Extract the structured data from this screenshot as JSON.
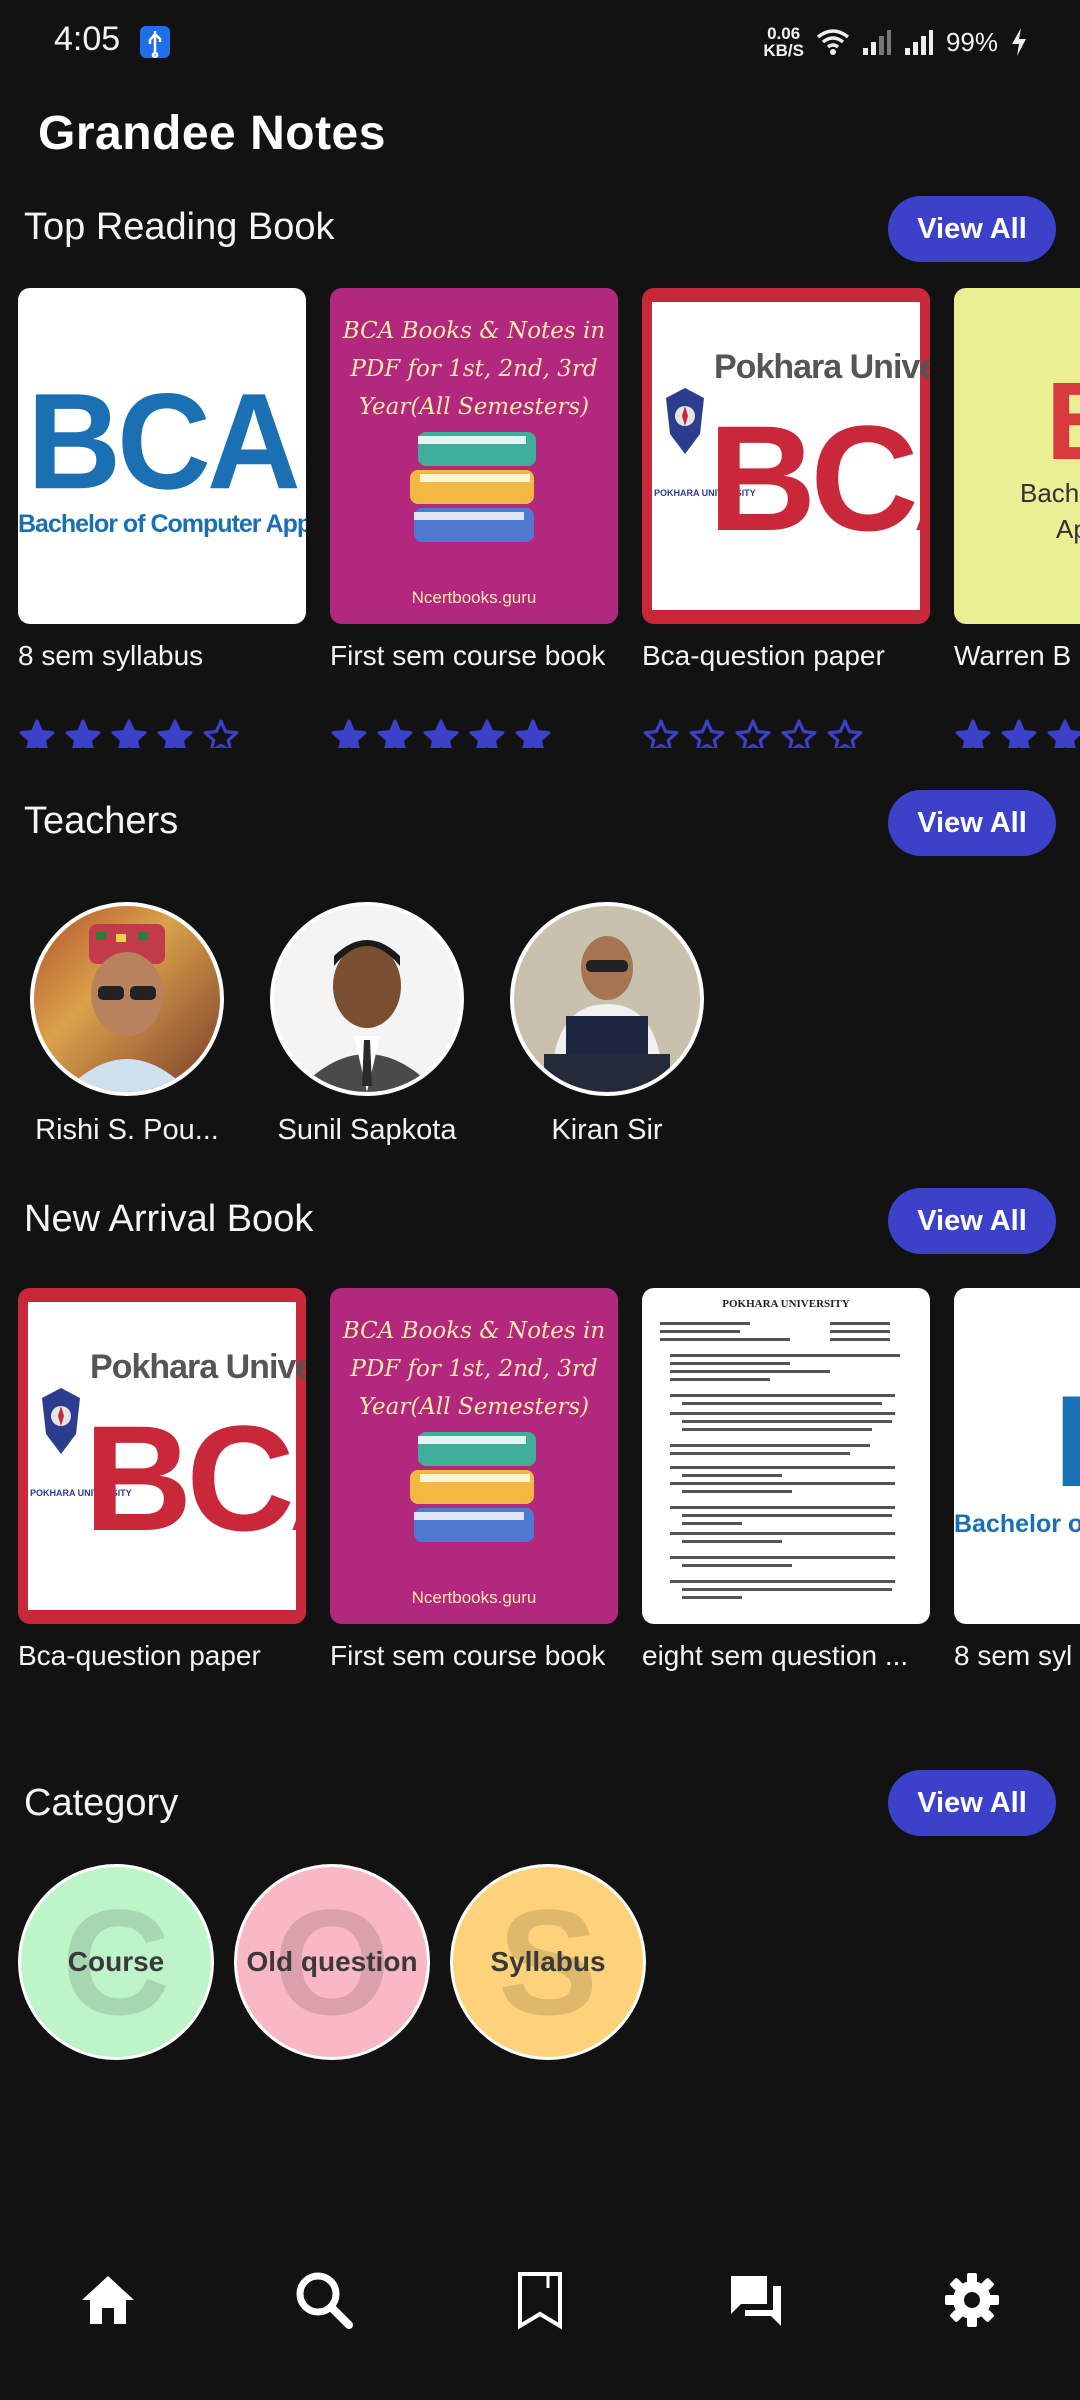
{
  "status": {
    "time": "4:05",
    "net_speed_value": "0.06",
    "net_speed_unit": "KB/S",
    "battery": "99%"
  },
  "app": {
    "title": "Grandee Notes"
  },
  "colors": {
    "accent": "#3b42c9",
    "background": "#121212",
    "star": "#3b42c9"
  },
  "top_reading": {
    "title": "Top Reading Book",
    "view_all": "View All",
    "books": [
      {
        "title": "8 sem syllabus",
        "cover_big": "BCA",
        "cover_sub": "Bachelor of Computer Application",
        "rating": 4
      },
      {
        "title": "First sem course book",
        "cover_text": "BCA Books & Notes in PDF for 1st, 2nd, 3rd Year(All Semesters)",
        "cover_footer": "Ncertbooks.guru",
        "rating": 5
      },
      {
        "title": "Bca-question paper",
        "cover_top": "Pokhara University",
        "cover_big": "BCA",
        "cover_side": "POKHARA UNIVERSITY",
        "rating": 0
      },
      {
        "title": "Warren B",
        "cover_big": "B",
        "cover_sub": "Bachel",
        "cover_sub2": "Ap",
        "rating": 3
      }
    ]
  },
  "teachers": {
    "title": "Teachers",
    "view_all": "View All",
    "items": [
      {
        "name": "Rishi S. Pou..."
      },
      {
        "name": "Sunil Sapkota"
      },
      {
        "name": "Kiran Sir"
      }
    ]
  },
  "new_arrival": {
    "title": "New Arrival Book",
    "view_all": "View All",
    "books": [
      {
        "title": "Bca-question paper",
        "cover_top": "Pokhara University",
        "cover_big": "BCA",
        "cover_side": "POKHARA UNIVERSITY"
      },
      {
        "title": "First sem course book",
        "cover_text": "BCA Books & Notes in PDF for 1st, 2nd, 3rd Year(All Semesters)",
        "cover_footer": "Ncertbooks.guru"
      },
      {
        "title": "eight sem question ...",
        "doc_heading": "POKHARA UNIVERSITY"
      },
      {
        "title": "8 sem syl",
        "cover_big": "B",
        "cover_sub": "Bachelor of Co"
      }
    ]
  },
  "category": {
    "title": "Category",
    "view_all": "View All",
    "items": [
      {
        "label": "Course",
        "letter": "C",
        "color": "#bdf5c9"
      },
      {
        "label": "Old question",
        "letter": "O",
        "color": "#f9b8c4"
      },
      {
        "label": "Syllabus",
        "letter": "S",
        "color": "#fdd27a"
      }
    ]
  },
  "nav": {
    "items": [
      {
        "icon": "home-icon"
      },
      {
        "icon": "search-icon"
      },
      {
        "icon": "bookmark-icon"
      },
      {
        "icon": "chat-icon"
      },
      {
        "icon": "settings-icon"
      }
    ]
  }
}
